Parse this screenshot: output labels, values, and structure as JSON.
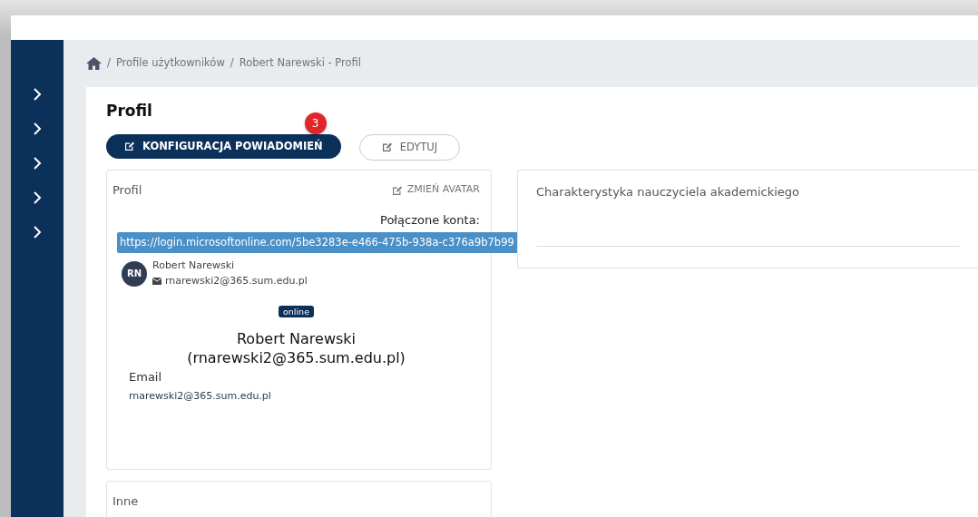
{
  "sidebar": {
    "items": [
      {
        "kind": "chevron"
      },
      {
        "kind": "chevron"
      },
      {
        "kind": "chevron"
      },
      {
        "kind": "chevron"
      },
      {
        "kind": "chevron"
      }
    ]
  },
  "breadcrumb": [
    {
      "separator": "/",
      "label": "Profile użytkowników"
    },
    {
      "separator": "/",
      "label": "Robert Narewski - Profil"
    }
  ],
  "page_title": "Profil",
  "buttons": [
    {
      "label": "KONFIGURACJA POWIADOMIEŃ",
      "kind": "primary",
      "badge": "3"
    },
    {
      "label": "EDYTUJ",
      "kind": "outline"
    }
  ],
  "profile_card": {
    "title": "Profil",
    "action": "ZMIEŃ AVATAR",
    "linked_label": "Połączone konta:",
    "linked_url": "https://login.microsoftonline.com/5be3283e-e466-475b-938a-c376a9b7b99",
    "account": {
      "initials": "RN",
      "name": "Robert Narewski",
      "email": "rnarewski2@365.sum.edu.pl"
    },
    "status": "online",
    "full_name": "Robert Narewski",
    "full_email": "(rnarewski2@365.sum.edu.pl)",
    "email_label": "Email",
    "email_value": "rnarewski2@365.sum.edu.pl"
  },
  "other_card": {
    "title": "Inne"
  },
  "right_card": {
    "title": "Charakterystyka nauczyciela akademickiego"
  }
}
